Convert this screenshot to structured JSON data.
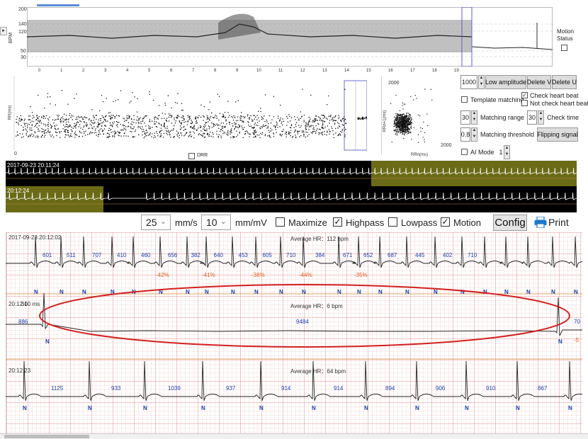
{
  "trend": {
    "ylabel": "BPM",
    "yticks": [
      "200",
      "140",
      "120",
      "50",
      "30"
    ],
    "xticks": [
      "0",
      "1",
      "2",
      "3",
      "4",
      "5",
      "6",
      "7",
      "8",
      "9",
      "10",
      "11",
      "12",
      "13",
      "14",
      "15",
      "16",
      "17",
      "18",
      "19"
    ],
    "motion_label": "Motion",
    "status_label": "Status"
  },
  "scatter": {
    "ylabel": "RR(ms)",
    "x0": "0",
    "drr_label": "DRR",
    "poincare_ymax": "2000",
    "poincare_xmax": "2000",
    "poincare_ylabel": "RRn+1(ms)",
    "poincare_xlabel": "RRn(ms)"
  },
  "controls": {
    "amp_value": "1000",
    "low_amplitude": "Low amplitude",
    "delete_v": "Delete V",
    "delete_u": "Delete U",
    "template_matching": "Template matching",
    "check_heart_beat": "Check heart beat",
    "not_check_heart_beat": "Not check heart beat",
    "matching_range_value": "30",
    "matching_range": "Matching range",
    "check_time_value": "30",
    "check_time": "Check time",
    "matching_threshold_value": "0.8",
    "matching_threshold": "Matching threshold",
    "flipping_signal": "Flipping signal",
    "ai_mode": "AI Mode",
    "ai_mode_value": "1"
  },
  "overview": {
    "strip1_time": "2017-09-23 20:11:24",
    "strip2_time": "20:12:24"
  },
  "toolbar": {
    "speed_value": "25",
    "speed_unit": "mm/s",
    "gain_value": "10",
    "gain_unit": "mm/mV",
    "maximize": "Maximize",
    "highpass": "Highpass",
    "lowpass": "Lowpass",
    "motion": "Motion",
    "config": "Config",
    "print": "Print"
  },
  "strips": [
    {
      "time": "2017-09-23 20:12:02",
      "avg_hr": "Average HR：112 bpm",
      "rr": [
        "601",
        "511",
        "707",
        "410",
        "460",
        "656",
        "382",
        "640",
        "453",
        "605",
        "710",
        "384",
        "671",
        "652",
        "687",
        "445",
        "402",
        "710"
      ],
      "pct": [
        "-42%",
        "-41%",
        "-38%",
        "-44%",
        "-35%"
      ]
    },
    {
      "time": "20:12:1",
      "scale": "500 ms",
      "avg_hr": "Average HR：6 bpm",
      "rr": [
        "886",
        "9484",
        "70"
      ],
      "pct": [
        "-5"
      ]
    },
    {
      "time": "20:12:23",
      "avg_hr": "Average HR：64 bpm",
      "rr": [
        "1125",
        "933",
        "1039",
        "937",
        "914",
        "914",
        "894",
        "906",
        "910",
        "867"
      ]
    }
  ],
  "beat_label": "N",
  "colors": {
    "highlight": "#6b6b17",
    "pause_oval": "#d22020",
    "rr_text": "#1a3fb0",
    "pct_text": "#e05a1e"
  }
}
